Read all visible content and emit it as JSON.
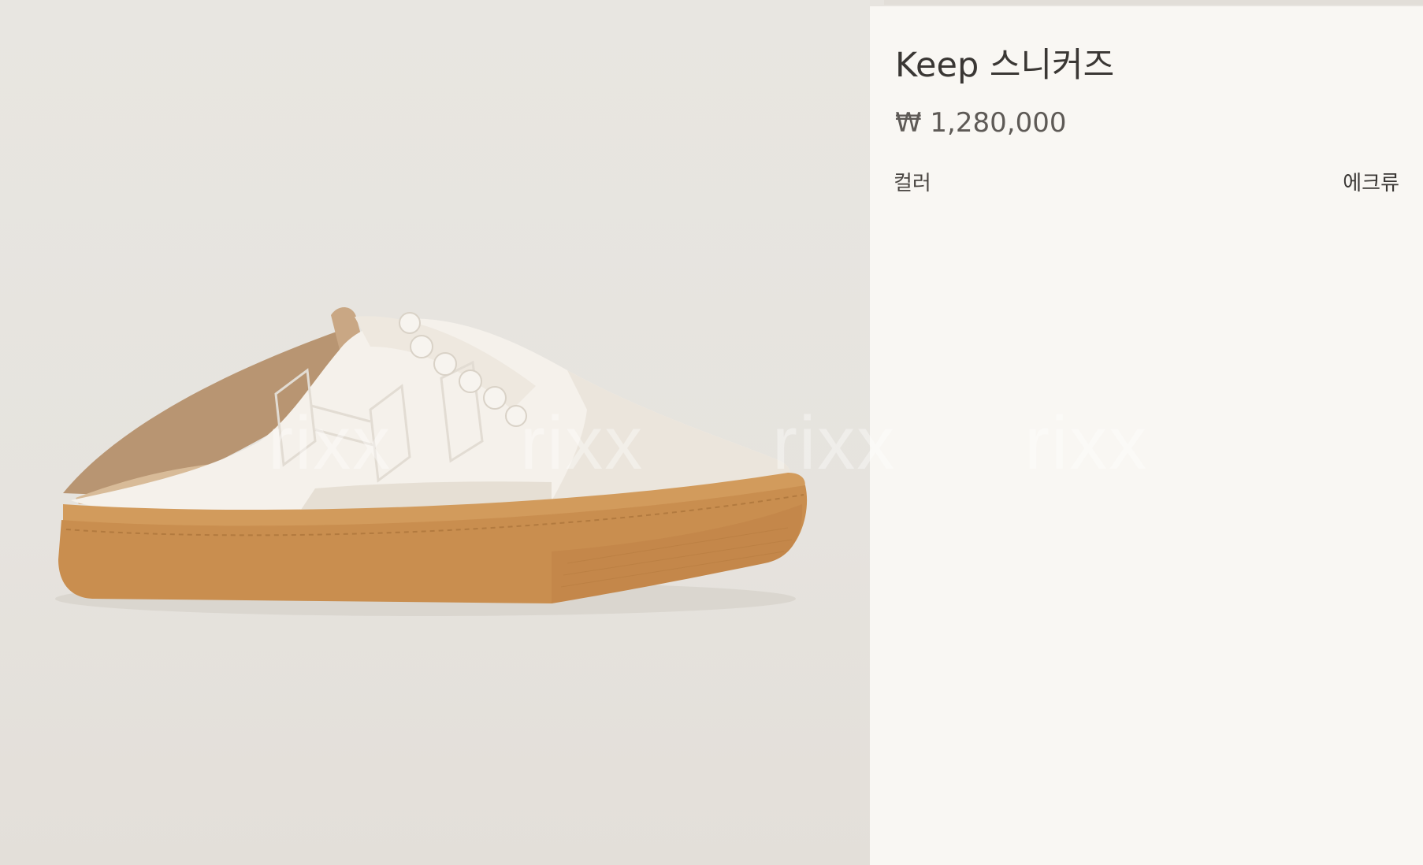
{
  "product": {
    "title": "Keep 스니커즈",
    "price": "₩ 1,280,000",
    "color_label": "컬러",
    "color_value": "에크류"
  },
  "image": {
    "subject": "sneaker-mule-image",
    "watermark_text": "rixx"
  },
  "colors": {
    "page_background": "#e7e4df",
    "info_panel_background": "#f9f7f3",
    "sole": "#c98e4f",
    "upper": "#f4f0ea"
  }
}
